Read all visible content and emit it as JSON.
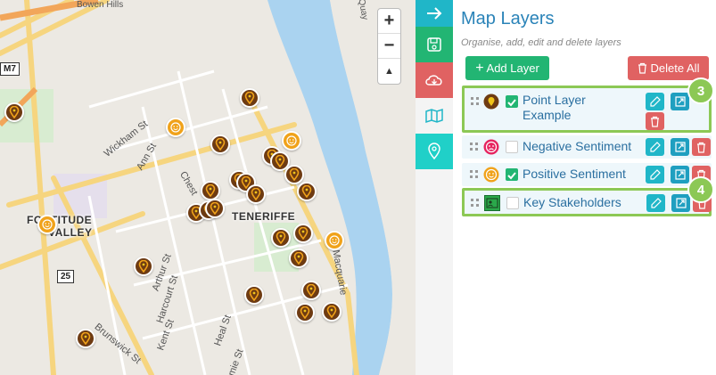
{
  "map": {
    "labels": {
      "bowen_hills": "Bowen Hills",
      "district_fortitude": "FORTITUDE",
      "district_valley": "VALLEY",
      "district_teneriffe": "TENERIFFE",
      "wickham": "Wickham St",
      "ann": "Ann St",
      "chest": "Chest",
      "arthur": "Arthur St",
      "harcourt": "Harcourt St",
      "kent": "Kent St",
      "heal": "Heal St",
      "brunswick": "Brunswick St",
      "macquarie": "Macquarie",
      "quay": "Quay",
      "amie": "amie St",
      "route_m7": "M7",
      "route_25": "25"
    },
    "zoom": {
      "in": "+",
      "out": "−",
      "north": "▲"
    }
  },
  "panel": {
    "title": "Map Layers",
    "subtitle": "Organise, add, edit and delete layers",
    "add_label": "Add Layer",
    "add_plus": "+",
    "delete_all_label": "Delete All",
    "layers": [
      {
        "name_line1": "Point Layer",
        "name_line2": "Example",
        "checked": true,
        "badge": "3"
      },
      {
        "name": "Negative Sentiment",
        "checked": false
      },
      {
        "name": "Positive Sentiment",
        "checked": true
      },
      {
        "name": "Key Stakeholders",
        "checked": false,
        "badge": "4"
      }
    ]
  },
  "colors": {
    "accent": "#2a83b8",
    "green": "#22b573",
    "red": "#e06262",
    "teal": "#20b6c8",
    "highlight": "#8cc855",
    "point_marker": "#6e3b12",
    "smile_marker": "#f0a21a"
  }
}
